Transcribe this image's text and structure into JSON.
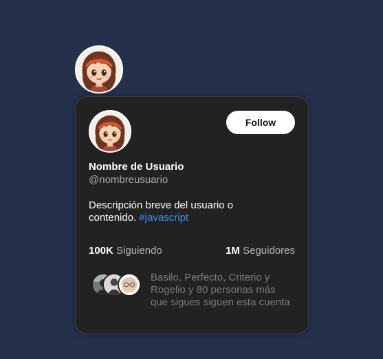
{
  "profile": {
    "display_name": "Nombre de Usuario",
    "handle": "@nombreusuario",
    "bio_text": "Descripción breve del usuario o contenido. ",
    "bio_hashtag": "#javascript",
    "avatar_icon": "girl-avatar-icon"
  },
  "actions": {
    "follow_label": "Follow"
  },
  "stats": {
    "following_count": "100K",
    "following_label": "Siguiendo",
    "followers_count": "1M",
    "followers_label": "Seguidores"
  },
  "mutuals": {
    "text": "Basilo, Perfecto, Criterio y Rogelio y 80 personas más que sigues siguen esta cuenta"
  },
  "colors": {
    "page_background": "#25314c",
    "card_background": "#222222",
    "hashtag": "#3a8ff0",
    "follow_button": "#ffffff"
  }
}
